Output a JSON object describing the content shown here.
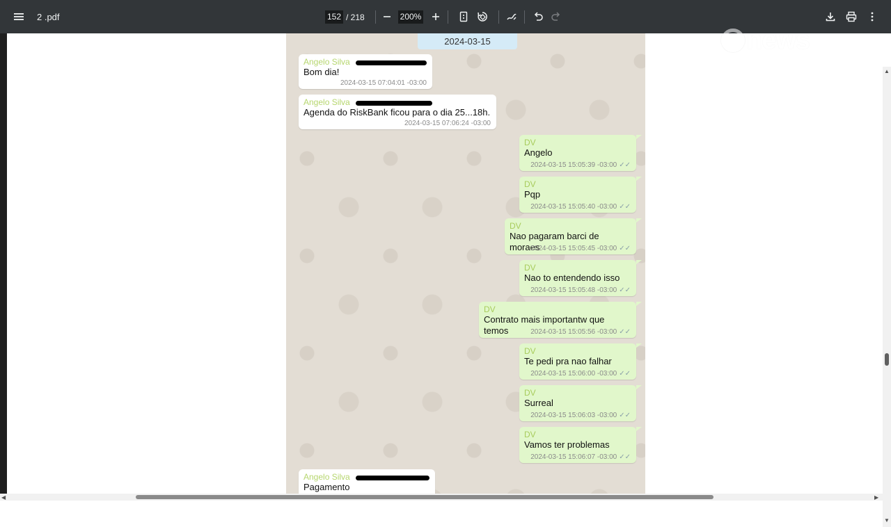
{
  "toolbar": {
    "menu_icon": "menu-icon",
    "doc_title": "2 .pdf",
    "page_current": "152",
    "page_total": "/ 218",
    "zoom": "200%",
    "zoom_out_icon": "minus-icon",
    "zoom_in_icon": "plus-icon",
    "fit_icon": "fit-page-icon",
    "rotate_icon": "rotate-icon",
    "annotate_icon": "draw-icon",
    "undo_icon": "undo-icon",
    "redo_icon": "redo-icon",
    "download_icon": "download-icon",
    "print_icon": "print-icon",
    "more_icon": "more-vert-icon"
  },
  "watermark": {
    "text": "news"
  },
  "chat": {
    "date": "2024-03-15",
    "messages": [
      {
        "dir": "in",
        "sender": "Angelo Silva",
        "text": "Bom dia!",
        "time": "2024-03-15 07:04:01 -03:00"
      },
      {
        "dir": "in",
        "sender": "Angelo Silva",
        "text": "Agenda do RiskBank ficou para o dia 25...18h.",
        "time": "2024-03-15 07:06:24 -03:00"
      },
      {
        "dir": "out",
        "sender": "DV",
        "text": "Angelo",
        "time": "2024-03-15 15:05:39 -03:00"
      },
      {
        "dir": "out",
        "sender": "DV",
        "text": "Pqp",
        "time": "2024-03-15 15:05:40 -03:00"
      },
      {
        "dir": "out",
        "sender": "DV",
        "text": "Nao pagaram barci de moraes",
        "time": "2024-03-15 15:05:45 -03:00"
      },
      {
        "dir": "out",
        "sender": "DV",
        "text": "Nao to entendendo isso",
        "time": "2024-03-15 15:05:48 -03:00"
      },
      {
        "dir": "out",
        "sender": "DV",
        "text": "Contrato mais importantw que temos",
        "time": "2024-03-15 15:05:56 -03:00"
      },
      {
        "dir": "out",
        "sender": "DV",
        "text": "Te pedi pra nao falhar",
        "time": "2024-03-15 15:06:00 -03:00"
      },
      {
        "dir": "out",
        "sender": "DV",
        "text": "Surreal",
        "time": "2024-03-15 15:06:03 -03:00"
      },
      {
        "dir": "out",
        "sender": "DV",
        "text": "Vamos ter problemas",
        "time": "2024-03-15 15:06:07 -03:00"
      },
      {
        "dir": "in",
        "sender": "Angelo Silva",
        "text": "Pagamento",
        "time": ""
      }
    ]
  }
}
